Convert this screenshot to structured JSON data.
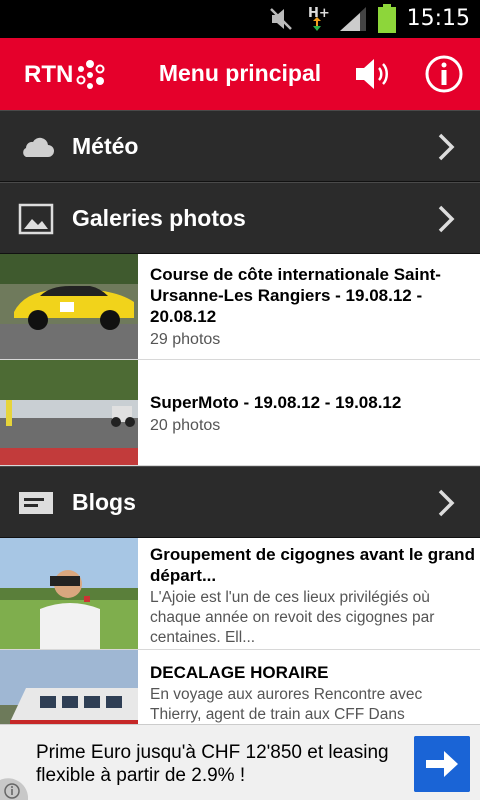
{
  "status_bar": {
    "time": "15:15",
    "network": "H+",
    "icons": [
      "mute-icon",
      "network-activity-icon",
      "signal-icon",
      "battery-icon"
    ]
  },
  "header": {
    "logo_text": "RTN",
    "title": "Menu principal",
    "accent_color": "#e5002b",
    "icons": [
      "speaker-icon",
      "info-icon"
    ]
  },
  "sections": {
    "meteo": {
      "label": "Météo",
      "icon": "cloud-icon"
    },
    "galeries": {
      "label": "Galeries photos",
      "icon": "image-icon"
    },
    "blogs": {
      "label": "Blogs",
      "icon": "blog-icon"
    }
  },
  "galleries": [
    {
      "title": "Course de côte internationale Saint-Ursanne-Les Rangiers - 19.08.12 - 20.08.12",
      "count": "29 photos"
    },
    {
      "title": "SuperMoto - 19.08.12 - 19.08.12",
      "count": "20 photos"
    }
  ],
  "blogs": [
    {
      "title": "Groupement de cigognes avant le grand départ...",
      "excerpt": "L'Ajoie est l'un de ces lieux privilégiés où chaque année on revoit des cigognes par centaines. Ell..."
    },
    {
      "title": "DECALAGE HORAIRE",
      "excerpt": "En voyage aux aurores Rencontre avec Thierry, agent de train aux CFF  Dans"
    }
  ],
  "ad": {
    "text": "Prime Euro jusqu'à CHF 12'850 et leasing flexible à partir de 2.9% !",
    "button_color": "#1a64d6"
  }
}
